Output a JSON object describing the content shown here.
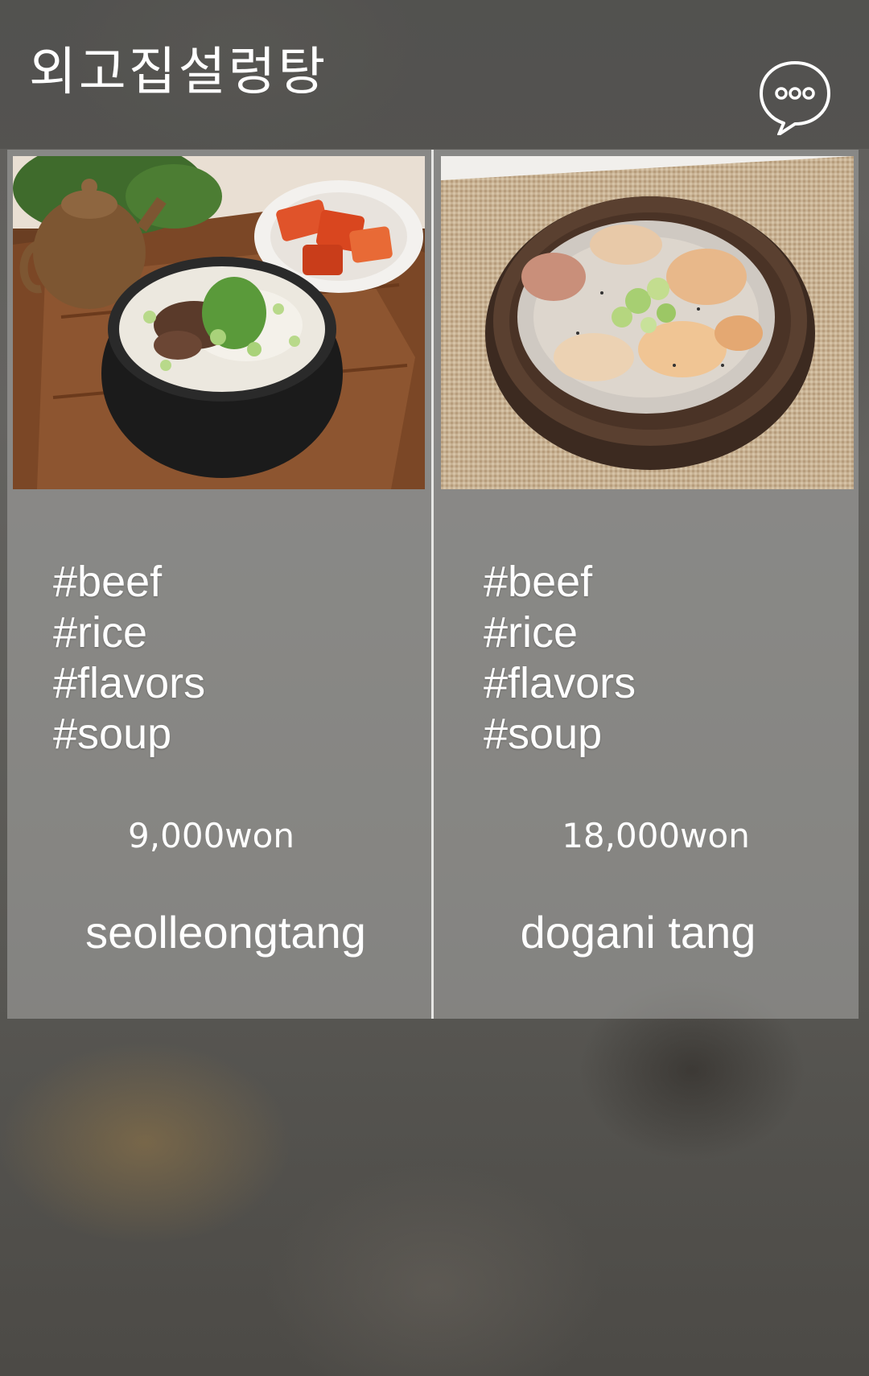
{
  "header": {
    "title": "외고집설렁탕",
    "menu_icon": "chat-bubble-ellipsis-icon"
  },
  "menu": {
    "items": [
      {
        "photo": "seolleongtang-bowl-photo",
        "tags": [
          "#beef",
          "#rice",
          "#flavors",
          "#soup"
        ],
        "price": "9,000won",
        "name": "seolleongtang"
      },
      {
        "photo": "dogani-tang-bowl-photo",
        "tags": [
          "#beef",
          "#rice",
          "#flavors",
          "#soup"
        ],
        "price": "18,000won",
        "name": "dogani tang"
      }
    ]
  },
  "colors": {
    "text": "#ffffff",
    "panel": "#aaaaa8",
    "divider": "#e6e6e4"
  }
}
